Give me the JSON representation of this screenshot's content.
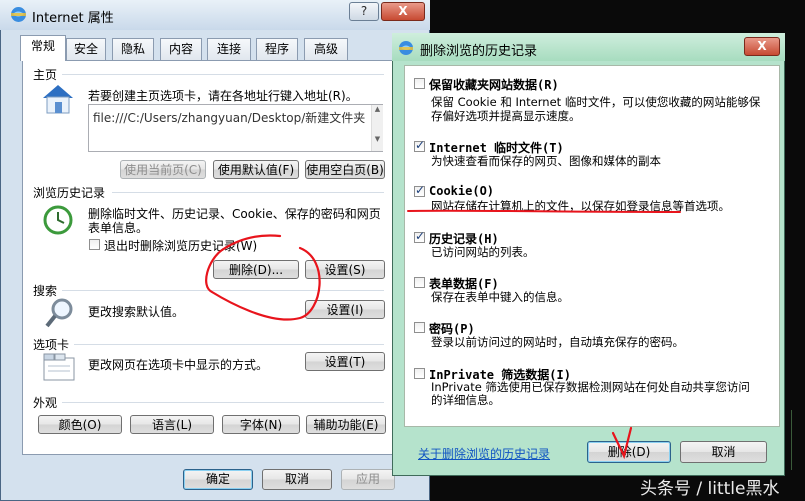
{
  "internet_properties": {
    "title": "Internet 属性",
    "window_buttons": {
      "help": "?",
      "close": "X"
    },
    "tabs": [
      {
        "label": "常规",
        "active": true
      },
      {
        "label": "安全",
        "active": false
      },
      {
        "label": "隐私",
        "active": false
      },
      {
        "label": "内容",
        "active": false
      },
      {
        "label": "连接",
        "active": false
      },
      {
        "label": "程序",
        "active": false
      },
      {
        "label": "高级",
        "active": false
      }
    ],
    "home": {
      "section_label": "主页",
      "description": "若要创建主页选项卡，请在各地址行键入地址(R)。",
      "url_value": "file:///C:/Users/zhangyuan/Desktop/新建文件夹",
      "use_current": "使用当前页(C)",
      "use_default": "使用默认值(F)",
      "use_blank": "使用空白页(B)"
    },
    "history": {
      "section_label": "浏览历史记录",
      "description_line1": "删除临时文件、历史记录、Cookie、保存的密码和网页",
      "description_line2": "表单信息。",
      "checkbox_label": "退出时删除浏览历史记录(W)",
      "checkbox_checked": false,
      "delete_button": "删除(D)...",
      "settings_button": "设置(S)"
    },
    "search": {
      "section_label": "搜索",
      "description": "更改搜索默认值。",
      "settings_button": "设置(I)"
    },
    "tabs_section": {
      "section_label": "选项卡",
      "description": "更改网页在选项卡中显示的方式。",
      "settings_button": "设置(T)"
    },
    "appearance": {
      "section_label": "外观",
      "colors_button": "颜色(O)",
      "languages_button": "语言(L)",
      "fonts_button": "字体(N)",
      "accessibility_button": "辅助功能(E)"
    },
    "footer": {
      "ok": "确定",
      "cancel": "取消",
      "apply": "应用"
    }
  },
  "delete_history_dialog": {
    "title": "删除浏览的历史记录",
    "window_close": "X",
    "options": [
      {
        "title": "保留收藏夹网站数据(R)",
        "desc": [
          "保留 Cookie 和 Internet 临时文件，可以使您收藏的网站能够保",
          "存偏好选项并提高显示速度。"
        ],
        "checked": false
      },
      {
        "title": "Internet 临时文件(T)",
        "desc": [
          "为快速查看而保存的网页、图像和媒体的副本"
        ],
        "checked": true
      },
      {
        "title": "Cookie(O)",
        "desc": [
          "网站存储在计算机上的文件，以保存如登录信息等首选项。"
        ],
        "checked": true
      },
      {
        "title": "历史记录(H)",
        "desc": [
          "已访问网站的列表。"
        ],
        "checked": true
      },
      {
        "title": "表单数据(F)",
        "desc": [
          "保存在表单中键入的信息。"
        ],
        "checked": false
      },
      {
        "title": "密码(P)",
        "desc": [
          "登录以前访问过的网站时，自动填充保存的密码。"
        ],
        "checked": false
      },
      {
        "title": "InPrivate 筛选数据(I)",
        "desc": [
          "InPrivate 筛选使用已保存数据检测网站在何处自动共享您访问",
          "的详细信息。"
        ],
        "checked": false
      }
    ],
    "about_link": "关于删除浏览的历史记录",
    "delete_button": "删除(D)",
    "cancel_button": "取消"
  },
  "watermark": "头条号 / little黑水",
  "colors": {
    "annotation_red": "#e8141c",
    "link_blue": "#1054c2",
    "dialog_frame": "#b5e3cc",
    "props_frame": "#d4e1ee"
  }
}
